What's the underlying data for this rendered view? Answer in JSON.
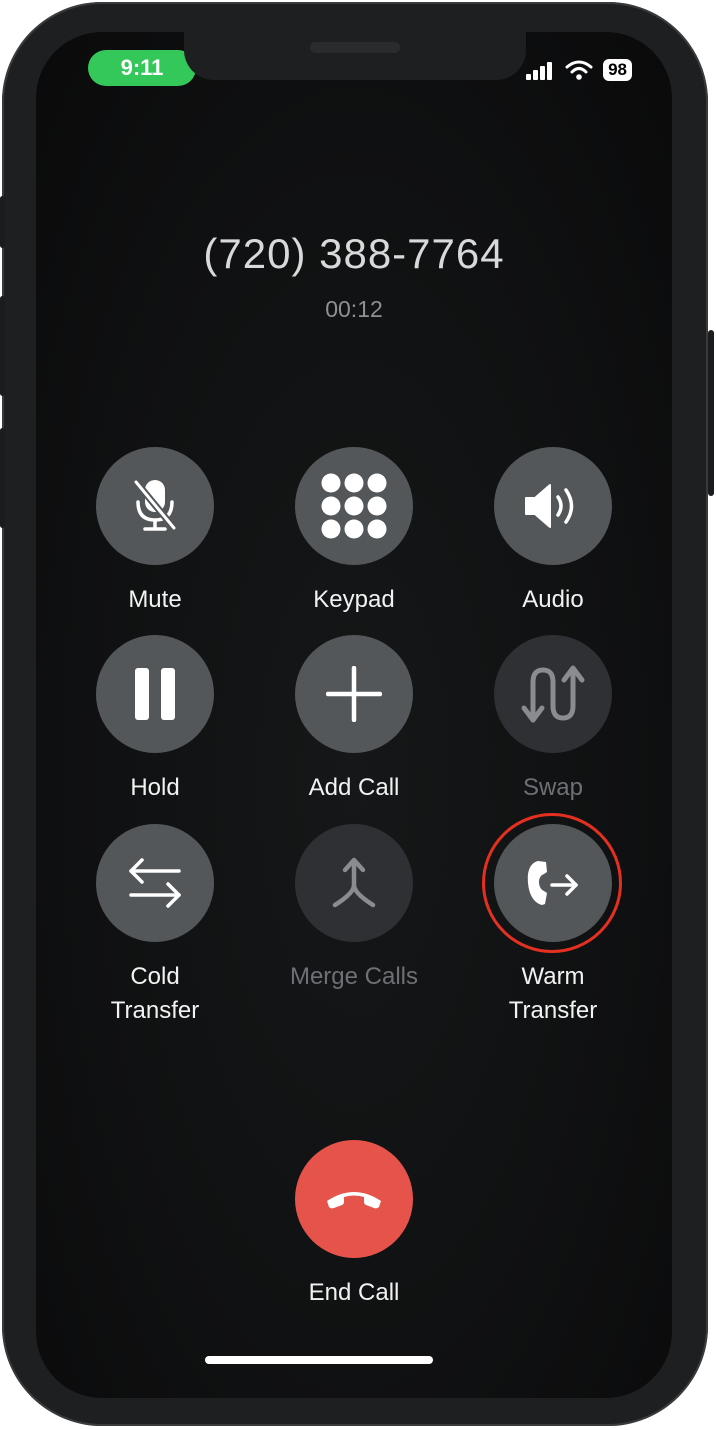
{
  "status_bar": {
    "time": "9:11",
    "battery": "98",
    "accent_color": "#34c759"
  },
  "call": {
    "number": "(720) 388-7764",
    "duration": "00:12"
  },
  "controls": {
    "mute": {
      "label": "Mute",
      "icon": "mic-slash-icon",
      "enabled": true
    },
    "keypad": {
      "label": "Keypad",
      "icon": "keypad-icon",
      "enabled": true
    },
    "audio": {
      "label": "Audio",
      "icon": "speaker-icon",
      "enabled": true
    },
    "hold": {
      "label": "Hold",
      "icon": "pause-icon",
      "enabled": true
    },
    "add_call": {
      "label": "Add Call",
      "icon": "plus-icon",
      "enabled": true
    },
    "swap": {
      "label": "Swap",
      "icon": "swap-arrows-icon",
      "enabled": false
    },
    "cold_transfer": {
      "label_line1": "Cold",
      "label_line2": "Transfer",
      "icon": "transfer-arrows-icon",
      "enabled": true
    },
    "merge_calls": {
      "label": "Merge Calls",
      "icon": "merge-icon",
      "enabled": false
    },
    "warm_transfer": {
      "label_line1": "Warm",
      "label_line2": "Transfer",
      "icon": "phone-forward-icon",
      "enabled": true,
      "highlighted": true,
      "highlight_color": "#e33021"
    }
  },
  "end_call": {
    "label": "End Call",
    "icon": "hang-up-icon",
    "color": "#e5534b"
  }
}
